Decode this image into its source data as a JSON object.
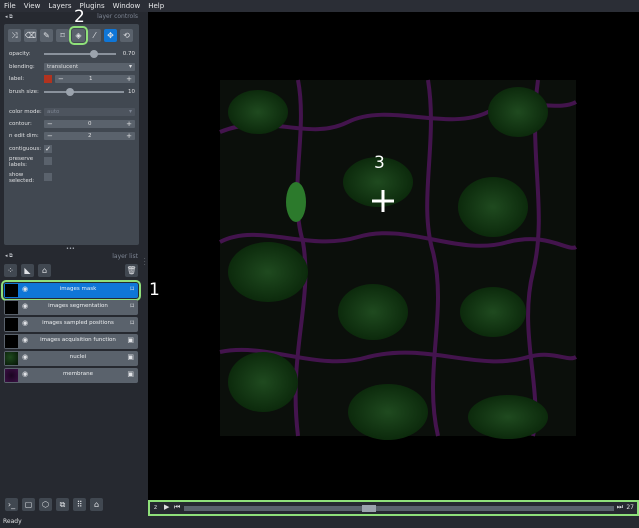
{
  "menu": [
    "File",
    "View",
    "Layers",
    "Plugins",
    "Window",
    "Help"
  ],
  "layer_controls": {
    "header": "layer controls",
    "opacity_label": "opacity:",
    "opacity_value": "0.70",
    "opacity_fraction": 0.7,
    "blending_label": "blending:",
    "blending_value": "translucent",
    "label_label": "label:",
    "label_value": "1",
    "label_color": "#b2331f",
    "brush_label": "brush size:",
    "brush_value": "10",
    "brush_fraction": 0.32,
    "color_mode_label": "color mode:",
    "color_mode_value": "auto",
    "contour_label": "contour:",
    "contour_value": "0",
    "n_edit_label": "n edit dim:",
    "n_edit_value": "2",
    "contiguous_label": "contiguous:",
    "contiguous_checked": true,
    "preserve_label": "preserve labels:",
    "show_selected_label": "show selected:",
    "minus": "−",
    "plus": "+",
    "dots": "•••"
  },
  "layer_list": {
    "header": "layer list",
    "layers": [
      {
        "name": "images mask",
        "selected": true,
        "type": "labels"
      },
      {
        "name": "images segmentation",
        "selected": false,
        "type": "labels"
      },
      {
        "name": "images sampled positions",
        "selected": false,
        "type": "labels"
      },
      {
        "name": "images acquisition function",
        "selected": false,
        "type": "image"
      },
      {
        "name": "nuclei",
        "selected": false,
        "type": "image"
      },
      {
        "name": "membrane",
        "selected": false,
        "type": "image"
      }
    ]
  },
  "dims": {
    "axis": "z",
    "value": "27",
    "position_fraction": 0.43
  },
  "status": "Ready",
  "annotations": {
    "a1": "1",
    "a2": "2",
    "a3": "3"
  },
  "colors": {
    "highlight": "#8fe07a",
    "accent": "#0f76d7",
    "background": "#262930",
    "panel": "#414851"
  }
}
